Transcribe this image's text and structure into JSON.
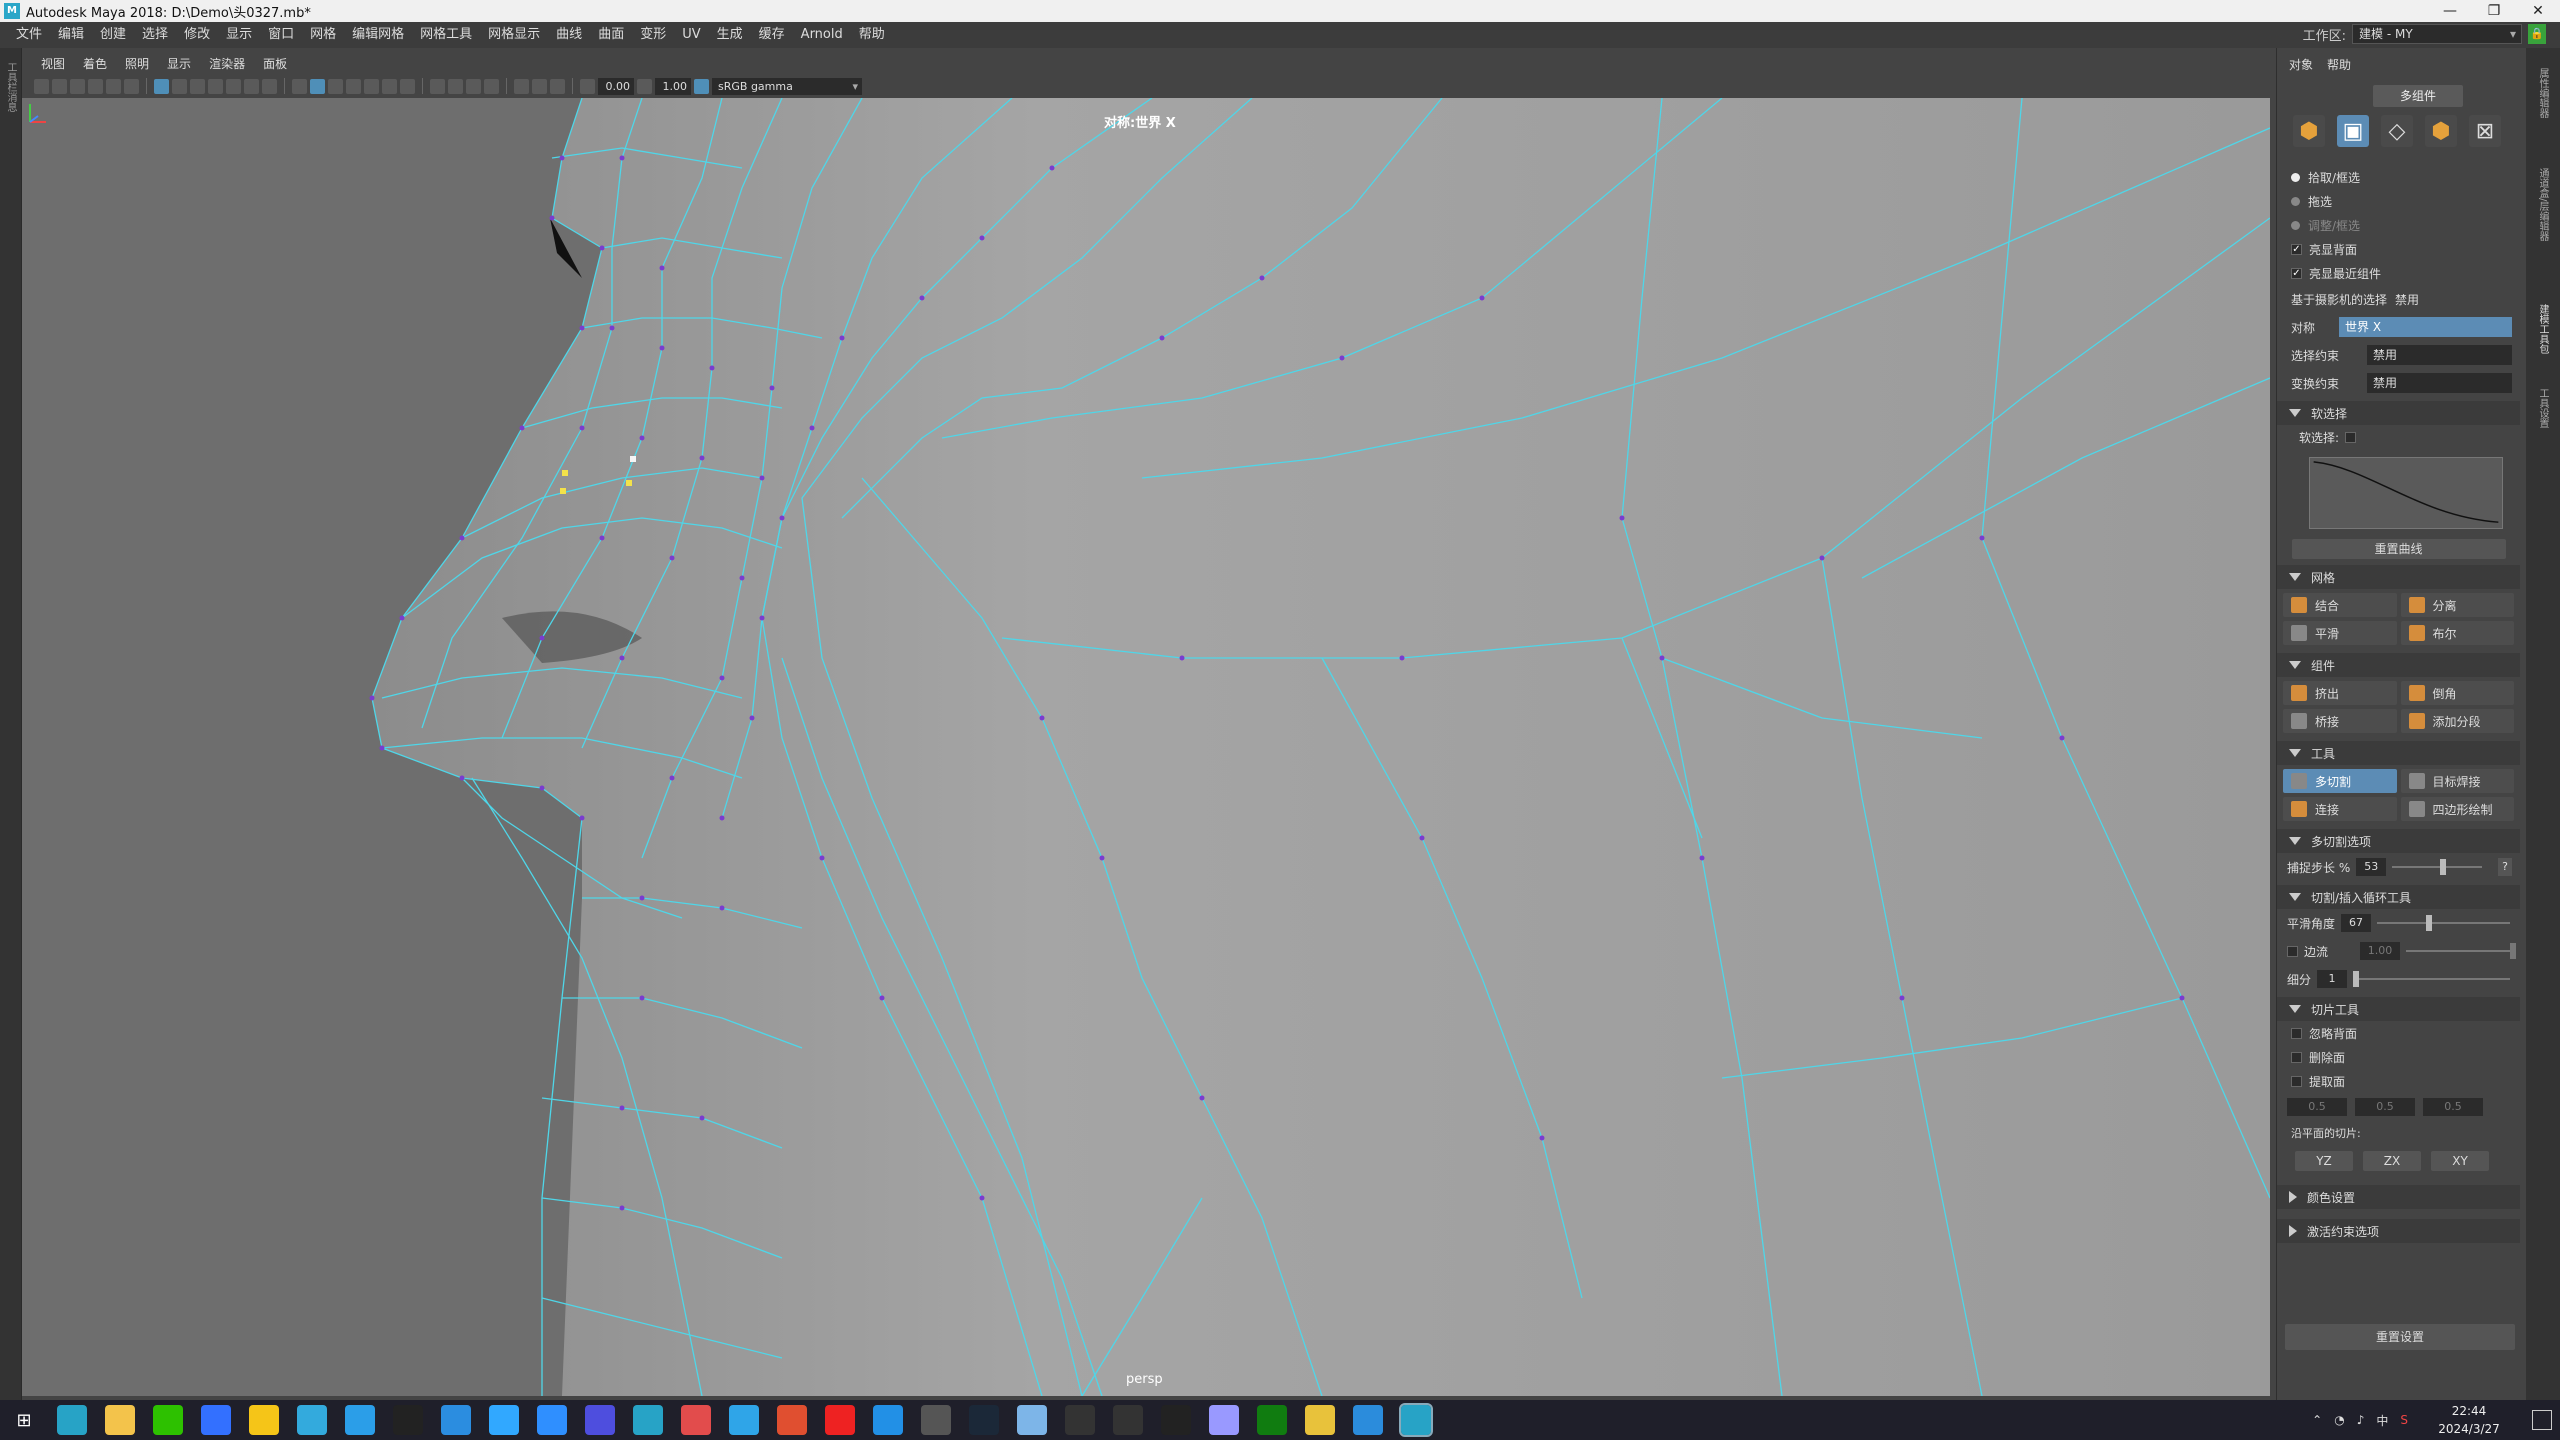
{
  "window": {
    "title": "Autodesk Maya 2018: D:\\Demo\\头0327.mb*",
    "app_icon": "M"
  },
  "menubar": {
    "items": [
      "文件",
      "编辑",
      "创建",
      "选择",
      "修改",
      "显示",
      "窗口",
      "网格",
      "编辑网格",
      "网格工具",
      "网格显示",
      "曲线",
      "曲面",
      "变形",
      "UV",
      "生成",
      "缓存",
      "Arnold",
      "帮助"
    ],
    "workspace_label": "工作区:",
    "workspace_value": "建模 - MY"
  },
  "left_strip": {
    "label": "工具栏消息"
  },
  "panel_menu": {
    "items": [
      "视图",
      "着色",
      "照明",
      "显示",
      "渲染器",
      "面板"
    ]
  },
  "viewport_toolbar": {
    "exposure": "0.00",
    "gamma_value": "1.00",
    "color_space": "sRGB gamma"
  },
  "viewport": {
    "symmetry_label": "对称:世界 X",
    "camera_label": "persp",
    "background": "#6e6e6e",
    "wire_color": "#4fd6e8",
    "vertex_color": "#7a3ccf",
    "selected_color": "#f3e24a"
  },
  "right_panel": {
    "tabs": [
      "对象",
      "帮助"
    ],
    "mode_label": "多组件",
    "select_options": [
      {
        "label": "拾取/框选",
        "on": true
      },
      {
        "label": "拖选",
        "on": false
      },
      {
        "label": "调整/框选",
        "on": false,
        "dim": true
      }
    ],
    "checkboxes": [
      {
        "label": "亮显背面",
        "checked": true
      },
      {
        "label": "亮显最近组件",
        "checked": true
      }
    ],
    "camera_select_label": "基于摄影机的选择",
    "camera_select_value": "禁用",
    "symmetry_label": "对称",
    "symmetry_value": "世界 X",
    "select_constraint_label": "选择约束",
    "select_constraint_value": "禁用",
    "transform_constraint_label": "变换约束",
    "transform_constraint_value": "禁用",
    "soft_select_section": "软选择",
    "soft_select_label": "软选择:",
    "reset_curve": "重置曲线",
    "mesh_section": "网格",
    "mesh_buttons": [
      "结合",
      "分离",
      "平滑",
      "布尔"
    ],
    "component_section": "组件",
    "component_buttons": [
      "挤出",
      "倒角",
      "桥接",
      "添加分段"
    ],
    "tools_section": "工具",
    "tool_buttons": [
      "多切割",
      "目标焊接",
      "连接",
      "四边形绘制"
    ],
    "multicut_section": "多切割选项",
    "snap_step_label": "捕捉步长 %",
    "snap_step_value": "53",
    "help_q": "?",
    "cut_loop_section": "切割/插入循环工具",
    "smooth_angle_label": "平滑角度",
    "smooth_angle_value": "67",
    "edge_flow_label": "边流",
    "edge_flow_value": "1.00",
    "subdiv_label": "细分",
    "subdiv_value": "1",
    "slice_section": "切片工具",
    "slice_checks": [
      "忽略背面",
      "删除面",
      "提取面"
    ],
    "slice_values": [
      "0.5",
      "0.5",
      "0.5"
    ],
    "along_plane_label": "沿平面的切片:",
    "planes": [
      "YZ",
      "ZX",
      "XY"
    ],
    "color_section": "颜色设置",
    "constraint_section": "激活约束选项",
    "reset_settings": "重置设置"
  },
  "right_strip": {
    "tabs": [
      "属性编辑器",
      "通道盒/层编辑器",
      "建模工具包",
      "工具设置"
    ]
  },
  "taskbar": {
    "clock_time": "22:44",
    "clock_date": "2024/3/27",
    "ime": "中",
    "icons": [
      "maya-icon",
      "explorer-icon",
      "wechat-icon",
      "feishu-icon",
      "qq-icon",
      "player-icon",
      "cloud-icon",
      "penguin-icon",
      "photos-icon",
      "photoshop-icon",
      "bili-icon",
      "vpn-icon",
      "maya-icon",
      "app-icon",
      "edge-icon",
      "swap-icon",
      "record-icon",
      "notes-icon",
      "tools-icon",
      "steam-icon",
      "settings-icon",
      "game-icon",
      "epic-icon",
      "terminal-icon",
      "ae-icon",
      "xbox-icon",
      "chrome-icon",
      "vscode-icon",
      "maya-active-icon"
    ],
    "icon_colors": [
      "#27a3c6",
      "#f3c34b",
      "#2dc100",
      "#3370ff",
      "#f5c518",
      "#33aadd",
      "#2b9ee8",
      "#222",
      "#2b8de0",
      "#31a8ff",
      "#2f8fff",
      "#4e4ede",
      "#27a3c6",
      "#e24c4c",
      "#2fa5e8",
      "#e04f30",
      "#e22",
      "#2290e6",
      "#555",
      "#1b2838",
      "#7db5e8",
      "#333",
      "#333",
      "#222",
      "#9999ff",
      "#107c10",
      "#e8c23b",
      "#2b8cdc",
      "#27a3c6"
    ]
  }
}
